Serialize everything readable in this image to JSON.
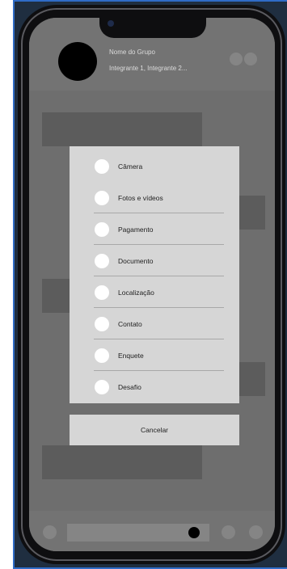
{
  "header": {
    "group_name": "Nome do Grupo",
    "members": "Integrante 1, Integrante 2..."
  },
  "attach_menu": {
    "options": [
      {
        "label": "Câmera"
      },
      {
        "label": "Fotos e vídeos"
      },
      {
        "label": "Pagamento"
      },
      {
        "label": "Documento"
      },
      {
        "label": "Localização"
      },
      {
        "label": "Contato"
      },
      {
        "label": "Enquete"
      },
      {
        "label": "Desafio"
      }
    ],
    "cancel_label": "Cancelar"
  }
}
